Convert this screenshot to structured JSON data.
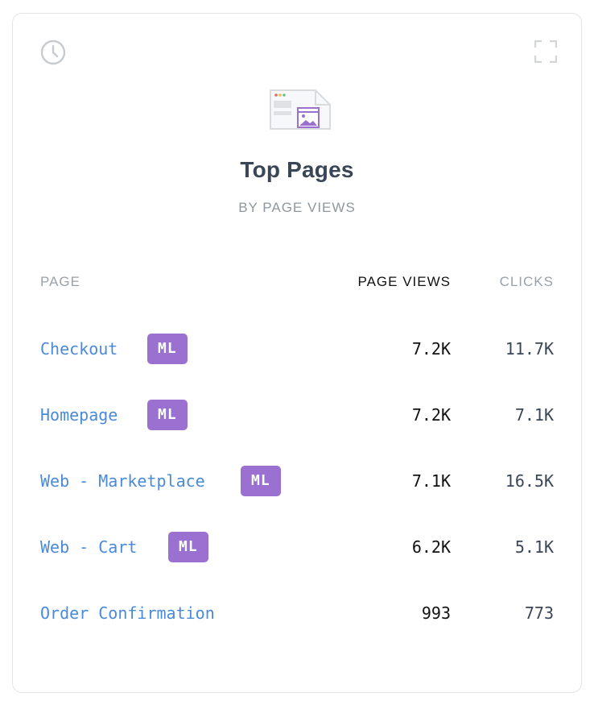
{
  "card": {
    "title": "Top Pages",
    "subtitle": "BY PAGE VIEWS",
    "icons": {
      "history": "clock-icon",
      "fullscreen": "expand-icon",
      "illustration": "pages-illustration"
    },
    "colors": {
      "accent": "#9a70d0",
      "link": "#4a8ad9",
      "title": "#3a4656"
    }
  },
  "table": {
    "columns": {
      "page": "PAGE",
      "views": "PAGE VIEWS",
      "clicks": "CLICKS"
    },
    "sorted_by": "views",
    "rows": [
      {
        "page": "Checkout",
        "badge": "ML",
        "views": "7.2K",
        "clicks": "11.7K"
      },
      {
        "page": "Homepage",
        "badge": "ML",
        "views": "7.2K",
        "clicks": "7.1K"
      },
      {
        "page": "Web - Marketplace",
        "badge": "ML",
        "views": "7.1K",
        "clicks": "16.5K"
      },
      {
        "page": "Web - Cart",
        "badge": "ML",
        "views": "6.2K",
        "clicks": "5.1K"
      },
      {
        "page": "Order Confirmation",
        "badge": "",
        "views": "993",
        "clicks": "773"
      }
    ]
  }
}
